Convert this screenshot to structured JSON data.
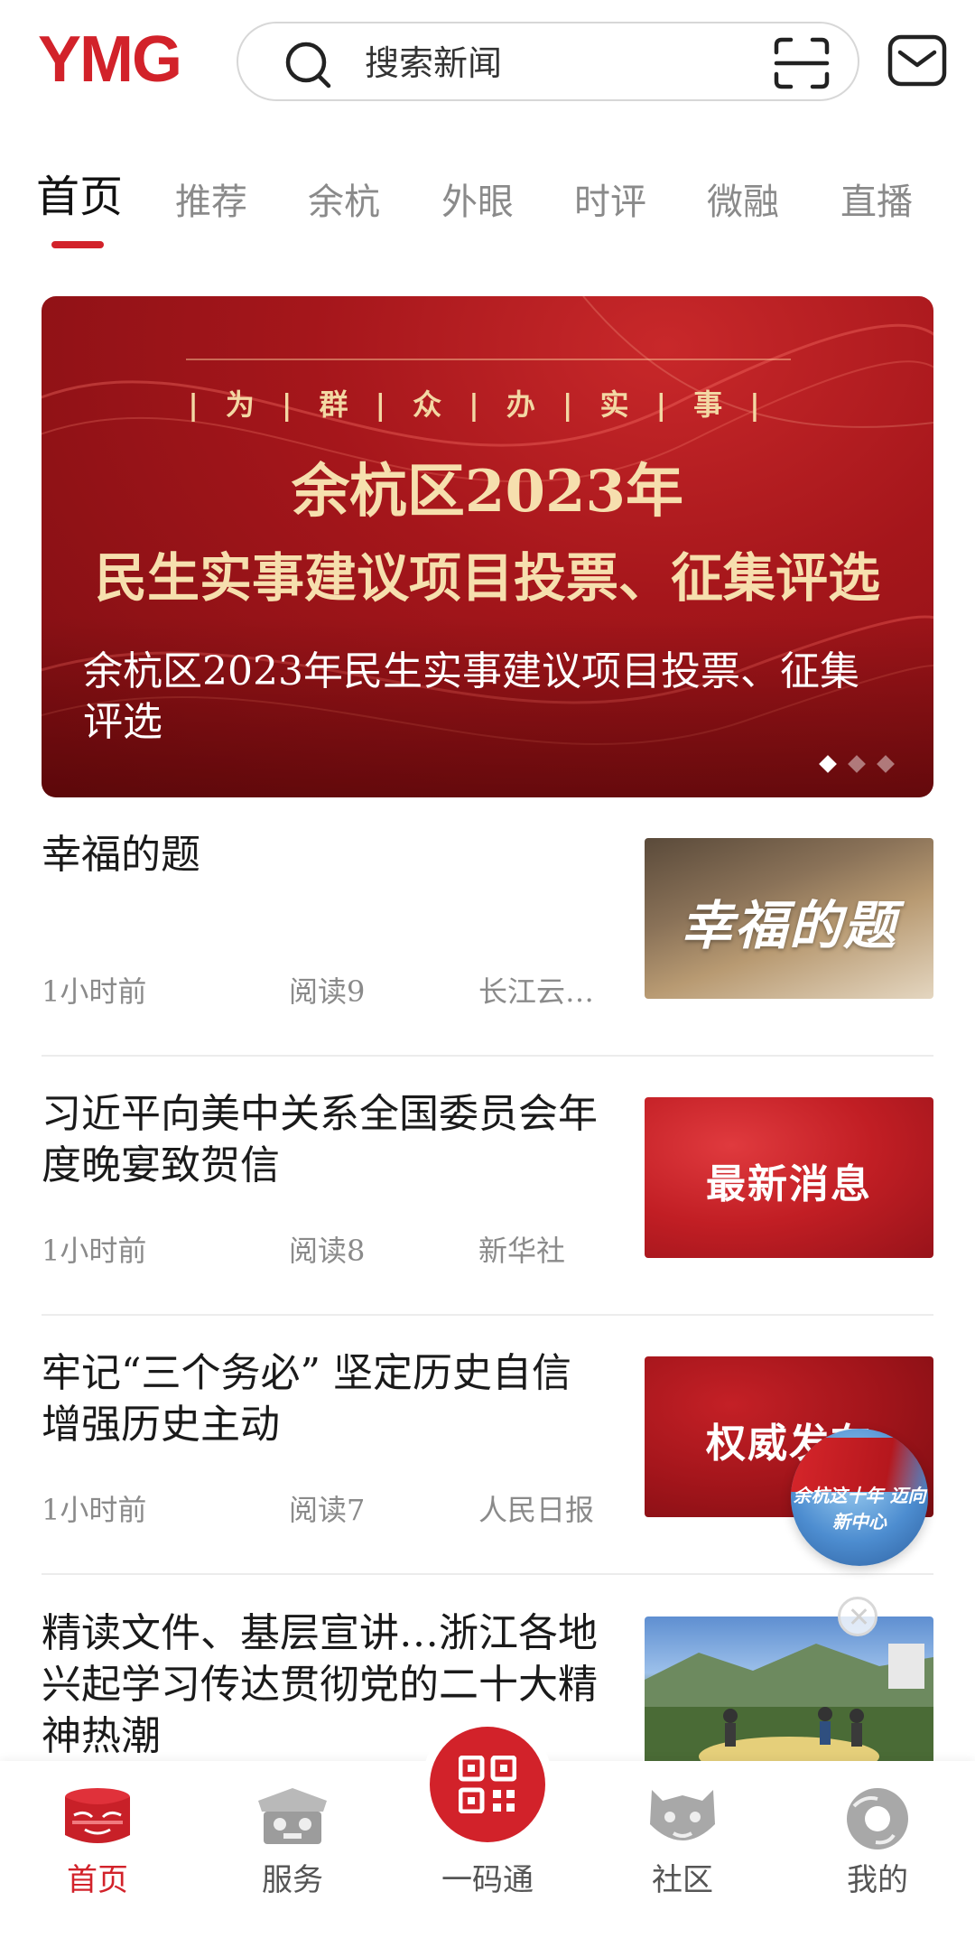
{
  "header": {
    "logo_text": "YMG",
    "search_placeholder": "搜索新闻",
    "icons": {
      "search": "search-icon",
      "scan": "scan-icon",
      "mail": "mail-icon"
    }
  },
  "tabs": [
    {
      "label": "首页",
      "active": true
    },
    {
      "label": "推荐"
    },
    {
      "label": "余杭"
    },
    {
      "label": "外眼"
    },
    {
      "label": "时评"
    },
    {
      "label": "微融"
    },
    {
      "label": "直播"
    }
  ],
  "banner": {
    "slogan": "|为|群|众|办|实|事|",
    "headline_line1": "余杭区2023年",
    "headline_line2": "民生实事建议项目投票、征集评选",
    "caption": "余杭区2023年民生实事建议项目投票、征集评选",
    "slide_count": 3,
    "active_slide": 1
  },
  "news": [
    {
      "title": "幸福的题",
      "time": "1小时前",
      "reads": "阅读9",
      "source": "长江云…",
      "thumb_text": "幸福的题"
    },
    {
      "title": "习近平向美中关系全国委员会年度晚宴致贺信",
      "time": "1小时前",
      "reads": "阅读8",
      "source": "新华社",
      "thumb_text": "最新消息"
    },
    {
      "title": "牢记“三个务必” 坚定历史自信 增强历史主动",
      "time": "1小时前",
      "reads": "阅读7",
      "source": "人民日报",
      "thumb_text": "权威发布"
    },
    {
      "title": "精读文件、基层宣讲…浙江各地兴起学习传达贯彻党的二十大精神热潮",
      "time": "",
      "reads": "",
      "source": "",
      "thumb_text": ""
    }
  ],
  "floating_badge": {
    "text": "余杭这十年 迈向新中心"
  },
  "bottom_nav": [
    {
      "label": "首页",
      "icon": "home-icon",
      "active": true
    },
    {
      "label": "服务",
      "icon": "service-icon"
    },
    {
      "label": "一码通",
      "icon": "qr-code-icon"
    },
    {
      "label": "社区",
      "icon": "community-icon"
    },
    {
      "label": "我的",
      "icon": "profile-icon"
    }
  ],
  "colors": {
    "accent": "#d2222a",
    "muted": "#8a8a8a",
    "banner_gold": "#f6dfae"
  }
}
